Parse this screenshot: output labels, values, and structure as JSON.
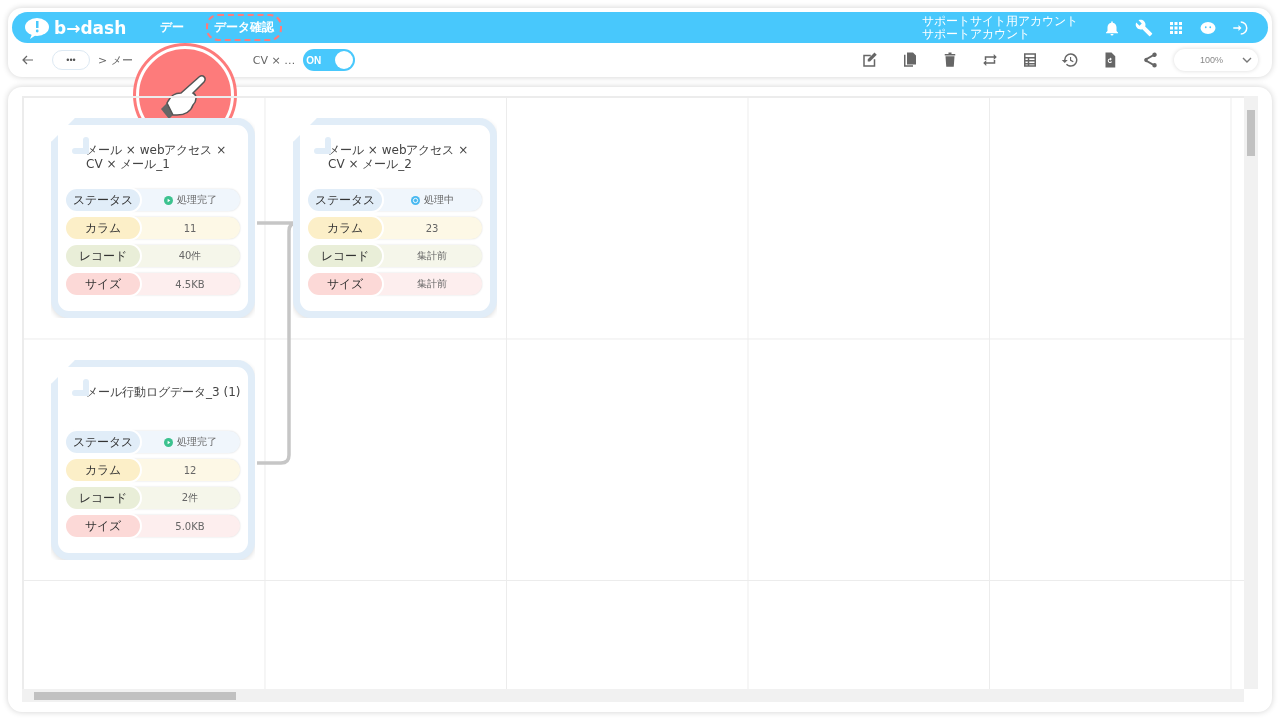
{
  "header": {
    "logo": "b→dash",
    "nav": [
      {
        "label": "デー",
        "selected": false
      },
      {
        "label": "データ確認",
        "selected": true
      }
    ],
    "account": [
      "サポートサイト用アカウント",
      "サポートアカウント"
    ]
  },
  "toolbar": {
    "more": "•••",
    "breadcrumb": [
      "> メー",
      "CV × …"
    ],
    "toggle": {
      "label": "ON",
      "on": true
    },
    "zoom": "100%"
  },
  "cards": [
    {
      "title": "メール × webアクセス × CV × メール_1",
      "rows": [
        {
          "kind": "status",
          "label": "ステータス",
          "value": "処理完了",
          "processing": false
        },
        {
          "kind": "column",
          "label": "カラム",
          "value": "11"
        },
        {
          "kind": "record",
          "label": "レコード",
          "value": "40件"
        },
        {
          "kind": "size",
          "label": "サイズ",
          "value": "4.5KB"
        }
      ]
    },
    {
      "title": "メール × webアクセス × CV × メール_2",
      "rows": [
        {
          "kind": "status",
          "label": "ステータス",
          "value": "処理中",
          "processing": true
        },
        {
          "kind": "column",
          "label": "カラム",
          "value": "23"
        },
        {
          "kind": "record",
          "label": "レコード",
          "value": "集計前"
        },
        {
          "kind": "size",
          "label": "サイズ",
          "value": "集計前"
        }
      ]
    },
    {
      "title": "メール行動ログデータ_3 (1)",
      "rows": [
        {
          "kind": "status",
          "label": "ステータス",
          "value": "処理完了",
          "processing": false
        },
        {
          "kind": "column",
          "label": "カラム",
          "value": "12"
        },
        {
          "kind": "record",
          "label": "レコード",
          "value": "2件"
        },
        {
          "kind": "size",
          "label": "サイズ",
          "value": "5.0KB"
        }
      ]
    }
  ]
}
